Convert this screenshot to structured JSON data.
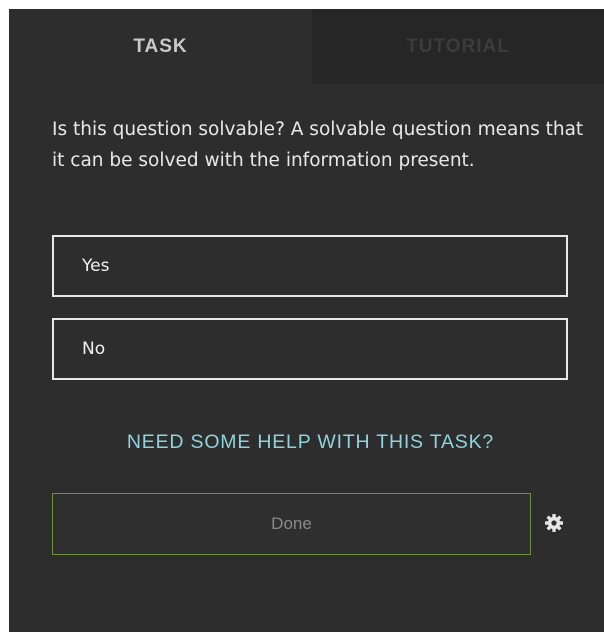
{
  "tabs": {
    "task_label": "TASK",
    "tutorial_label": "TUTORIAL"
  },
  "question": {
    "text": "Is this question solvable? A solvable question means that it can be solved with the information present."
  },
  "options": [
    {
      "label": "Yes"
    },
    {
      "label": "No"
    }
  ],
  "help": {
    "link_text": "NEED SOME HELP WITH THIS TASK?"
  },
  "done": {
    "label": "Done"
  },
  "icons": {
    "settings": "gear-icon"
  },
  "colors": {
    "panel_background": "#2d2d2d",
    "inactive_tab_background": "#262626",
    "help_link": "#8fd3dd",
    "done_border": "#6e8f42"
  }
}
